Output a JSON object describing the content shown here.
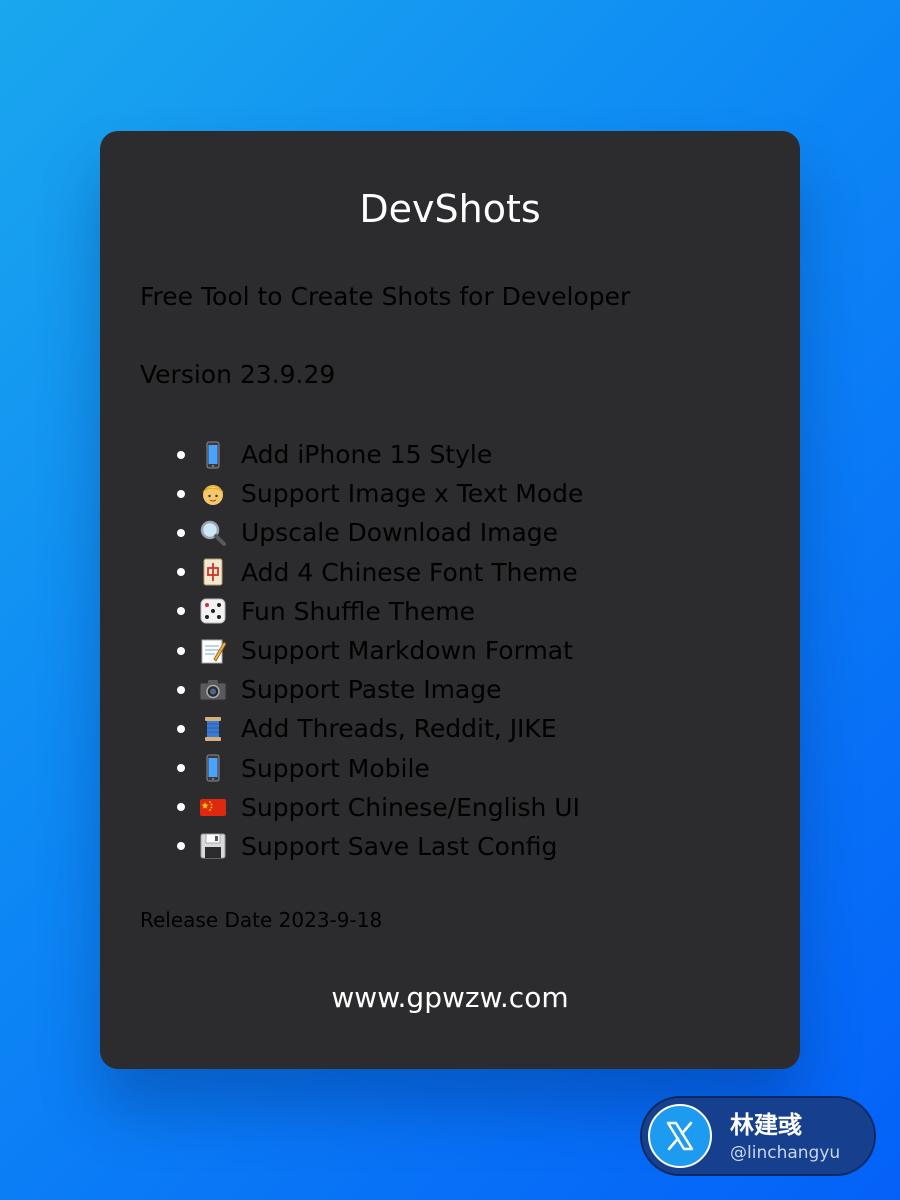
{
  "card": {
    "title": "DevShots",
    "subtitle": "Free Tool to Create Shots for Developer",
    "version": "Version 23.9.29",
    "features": [
      {
        "icon": "mobile-phone-icon",
        "label": "Add iPhone 15 Style"
      },
      {
        "icon": "person-icon",
        "label": "Support Image x Text Mode"
      },
      {
        "icon": "magnifier-icon",
        "label": "Upscale Download Image"
      },
      {
        "icon": "mahjong-tile-icon",
        "label": "Add 4 Chinese Font Theme"
      },
      {
        "icon": "dice-icon",
        "label": "Fun Shuffle Theme"
      },
      {
        "icon": "memo-icon",
        "label": "Support Markdown Format"
      },
      {
        "icon": "camera-icon",
        "label": "Support Paste Image"
      },
      {
        "icon": "thread-spool-icon",
        "label": "Add Threads, Reddit, JIKE"
      },
      {
        "icon": "mobile-phone-icon",
        "label": "Support Mobile"
      },
      {
        "icon": "china-flag-icon",
        "label": "Support Chinese/English UI"
      },
      {
        "icon": "floppy-disk-icon",
        "label": "Support Save Last Config"
      }
    ],
    "release_date": "Release Date 2023-9-18",
    "website": "www.gpwzw.com"
  },
  "author_badge": {
    "icon": "x-logo-icon",
    "name": "林建彧",
    "handle": "@linchangyu"
  },
  "colors": {
    "background_start": "#1aa7ee",
    "background_end": "#0461f8",
    "card": "#2c2c2e",
    "text": "#ffffff",
    "badge": "#163f8e",
    "x_logo": "#1d9bf0"
  }
}
